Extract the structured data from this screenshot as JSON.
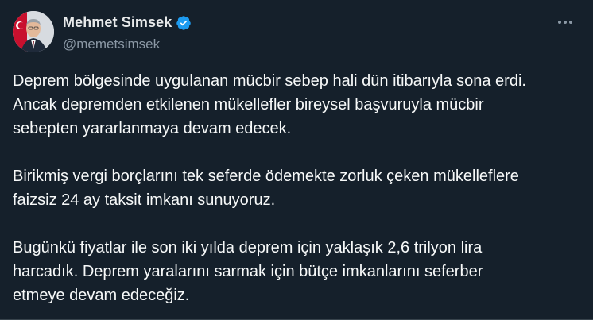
{
  "author": {
    "display_name": "Mehmet Simsek",
    "handle": "@memetsimsek",
    "verified": true
  },
  "icons": {
    "avatar": "avatar-photo",
    "verified": "verified-badge-icon",
    "more": "more-options-icon"
  },
  "colors": {
    "background": "#15202b",
    "text": "#f7f9f9",
    "secondary_text": "#8b98a5",
    "verified_blue": "#1d9bf0"
  },
  "tweet": {
    "paragraphs": [
      "Deprem bölgesinde uygulanan mücbir sebep hali dün itibarıyla sona erdi.\nAncak depremden etkilenen mükellefler bireysel başvuruyla mücbir\nsebepten yararlanmaya devam edecek.",
      "Birikmiş vergi borçlarını tek seferde ödemekte zorluk çeken mükelleflere\nfaizsiz 24 ay taksit imkanı sunuyoruz.",
      "Bugünkü fiyatlar ile son iki yılda deprem için yaklaşık 2,6 trilyon lira\nharcadık. Deprem yaralarını sarmak için bütçe imkanlarını seferber\netmeye devam edeceğiz."
    ]
  }
}
